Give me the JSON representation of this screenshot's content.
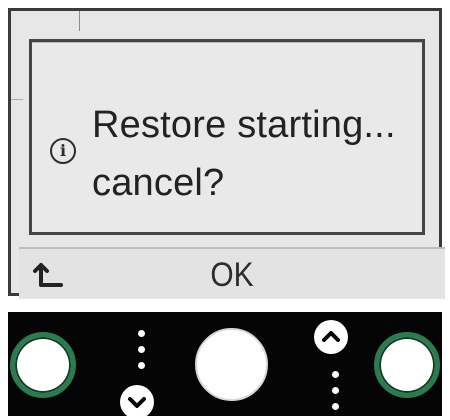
{
  "dialog": {
    "message_line_1": "Restore starting...",
    "message_line_2": "cancel?",
    "info_icon": "info-icon",
    "info_glyph": "i"
  },
  "soft_keys": {
    "back_icon": "return-arrow-icon",
    "ok_label": "OK"
  },
  "panel": {
    "left_button": "round-button-left",
    "center_button": "round-button-center",
    "right_button": "round-button-right",
    "down_icon": "chevron-down-icon",
    "up_icon": "chevron-up-icon"
  },
  "colors": {
    "lcd_background": "#e7e7e7",
    "lcd_border": "#3a3a3a",
    "button_ring": "#2a7b4e",
    "panel_background": "#050505"
  }
}
